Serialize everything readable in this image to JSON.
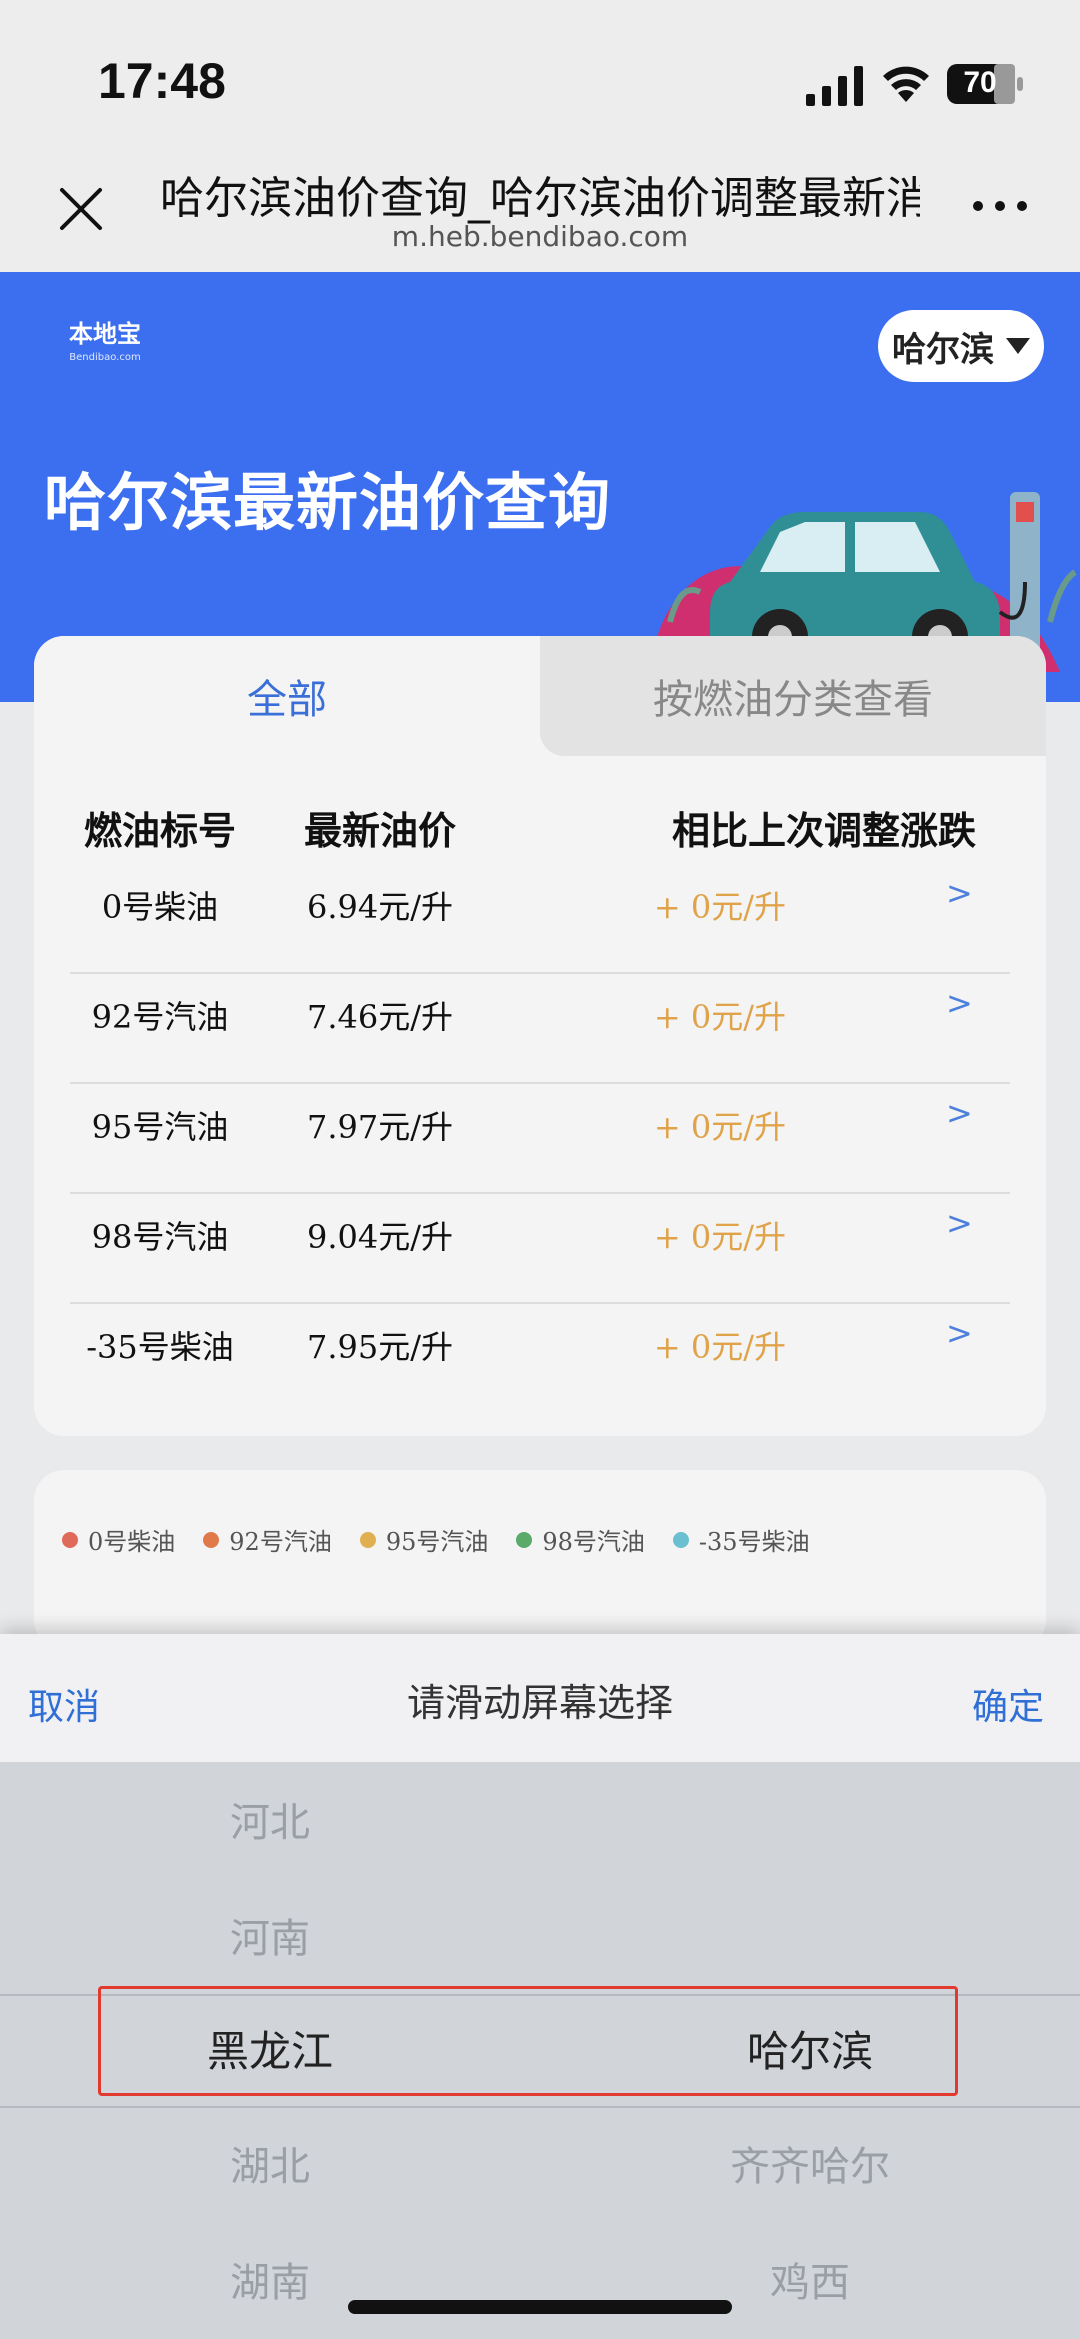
{
  "status_bar": {
    "time": "17:48",
    "battery": "70"
  },
  "browser": {
    "title": "哈尔滨油价查询_哈尔滨油价调整最新消息",
    "url": "m.heb.bendibao.com"
  },
  "hero": {
    "logo_text": "本地宝",
    "logo_sub": "Bendibao.com",
    "city": "哈尔滨",
    "title": "哈尔滨最新油价查询"
  },
  "tabs": [
    {
      "label": "全部",
      "active": true
    },
    {
      "label": "按燃油分类查看",
      "active": false
    }
  ],
  "table": {
    "headers": [
      "燃油标号",
      "最新油价",
      "相比上次调整涨跌"
    ],
    "rows": [
      {
        "name": "0号柴油",
        "price": "6.94元/升",
        "change": "+ 0元/升",
        "arrow": ">"
      },
      {
        "name": "92号汽油",
        "price": "7.46元/升",
        "change": "+ 0元/升",
        "arrow": ">"
      },
      {
        "name": "95号汽油",
        "price": "7.97元/升",
        "change": "+ 0元/升",
        "arrow": ">"
      },
      {
        "name": "98号汽油",
        "price": "9.04元/升",
        "change": "+ 0元/升",
        "arrow": ">"
      },
      {
        "name": "-35号柴油",
        "price": "7.95元/升",
        "change": "+ 0元/升",
        "arrow": ">"
      }
    ]
  },
  "legend": [
    {
      "label": "0号柴油",
      "color": "#e06a5a"
    },
    {
      "label": "92号汽油",
      "color": "#e07a4a"
    },
    {
      "label": "95号汽油",
      "color": "#e0b050"
    },
    {
      "label": "98号汽油",
      "color": "#5aaa6a"
    },
    {
      "label": "-35号柴油",
      "color": "#6ac0d0"
    }
  ],
  "picker": {
    "cancel": "取消",
    "title": "请滑动屏幕选择",
    "confirm": "确定",
    "provinces": [
      "河北",
      "河南",
      "黑龙江",
      "湖北",
      "湖南"
    ],
    "cities": [
      "哈尔滨",
      "齐齐哈尔",
      "鸡西"
    ],
    "selected_province": "黑龙江",
    "selected_city": "哈尔滨"
  },
  "colors": {
    "hero_bg": "#3c6ff0",
    "accent_blue": "#3a6fd8",
    "change_orange": "#e0a34a",
    "highlight_red": "#e23a2e"
  }
}
